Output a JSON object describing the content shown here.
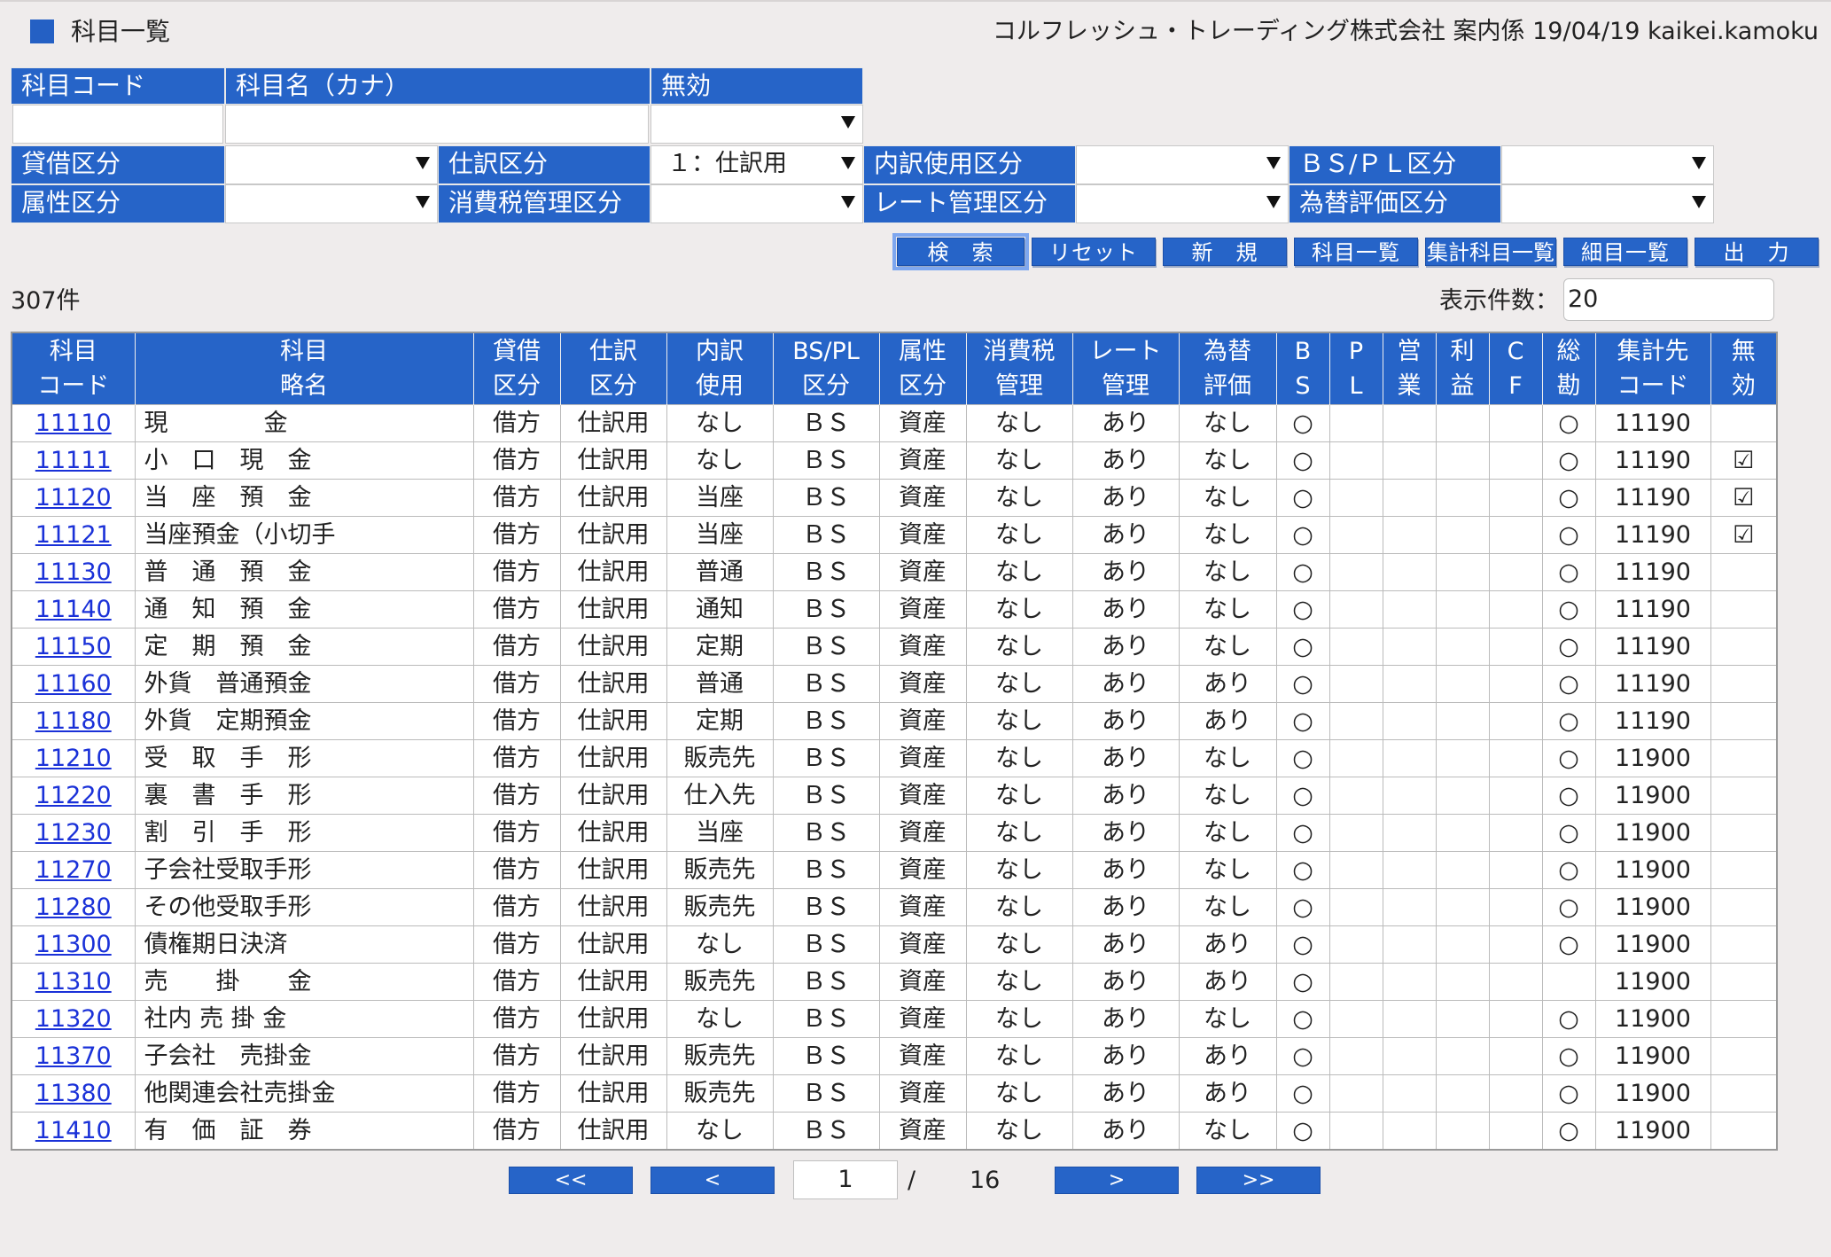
{
  "header": {
    "title": "科目一覧",
    "info": "コルフレッシュ・トレーディング株式会社 案内係 19/04/19 kaikei.kamoku"
  },
  "search": {
    "code_label": "科目コード",
    "code_value": "",
    "kana_label": "科目名（カナ）",
    "kana_value": "",
    "invalid_label": "無効",
    "invalid_value": "",
    "taishaku_label": "貸借区分",
    "taishaku_value": "",
    "shiwake_label": "仕訳区分",
    "shiwake_value": "１：仕訳用",
    "uchiwake_label": "内訳使用区分",
    "uchiwake_value": "",
    "bspl_label": "ＢＳ/ＰＬ区分",
    "bspl_value": "",
    "zokusei_label": "属性区分",
    "zokusei_value": "",
    "shohizei_label": "消費税管理区分",
    "shohizei_value": "",
    "rate_label": "レート管理区分",
    "rate_value": "",
    "kawase_label": "為替評価区分",
    "kawase_value": ""
  },
  "buttons": {
    "search": "検　索",
    "reset": "リセット",
    "new": "新　規",
    "kamoku_list": "科目一覧",
    "shukei_list": "集計科目一覧",
    "saimoku_list": "細目一覧",
    "output": "出　力"
  },
  "result_count": "307件",
  "page_size_label": "表示件数：",
  "page_size_value": "20",
  "columns": [
    [
      "科目",
      "コード"
    ],
    [
      "科目",
      "略名"
    ],
    [
      "貸借",
      "区分"
    ],
    [
      "仕訳",
      "区分"
    ],
    [
      "内訳",
      "使用"
    ],
    [
      "BS/PL",
      "区分"
    ],
    [
      "属性",
      "区分"
    ],
    [
      "消費税",
      "管理"
    ],
    [
      "レート",
      "管理"
    ],
    [
      "為替",
      "評価"
    ],
    [
      "B",
      "S"
    ],
    [
      "P",
      "L"
    ],
    [
      "営",
      "業"
    ],
    [
      "利",
      "益"
    ],
    [
      "C",
      "F"
    ],
    [
      "総",
      "勘"
    ],
    [
      "集計先",
      "コード"
    ],
    [
      "無",
      "効"
    ]
  ],
  "rows": [
    [
      "11110",
      "現　　　　金",
      "借方",
      "仕訳用",
      "なし",
      "ＢＳ",
      "資産",
      "なし",
      "あり",
      "なし",
      "○",
      "",
      "",
      "",
      "",
      "○",
      "11190",
      ""
    ],
    [
      "11111",
      "小　口　現　金",
      "借方",
      "仕訳用",
      "なし",
      "ＢＳ",
      "資産",
      "なし",
      "あり",
      "なし",
      "○",
      "",
      "",
      "",
      "",
      "○",
      "11190",
      "☑"
    ],
    [
      "11120",
      "当　座　預　金",
      "借方",
      "仕訳用",
      "当座",
      "ＢＳ",
      "資産",
      "なし",
      "あり",
      "なし",
      "○",
      "",
      "",
      "",
      "",
      "○",
      "11190",
      "☑"
    ],
    [
      "11121",
      "当座預金（小切手",
      "借方",
      "仕訳用",
      "当座",
      "ＢＳ",
      "資産",
      "なし",
      "あり",
      "なし",
      "○",
      "",
      "",
      "",
      "",
      "○",
      "11190",
      "☑"
    ],
    [
      "11130",
      "普　通　預　金",
      "借方",
      "仕訳用",
      "普通",
      "ＢＳ",
      "資産",
      "なし",
      "あり",
      "なし",
      "○",
      "",
      "",
      "",
      "",
      "○",
      "11190",
      ""
    ],
    [
      "11140",
      "通　知　預　金",
      "借方",
      "仕訳用",
      "通知",
      "ＢＳ",
      "資産",
      "なし",
      "あり",
      "なし",
      "○",
      "",
      "",
      "",
      "",
      "○",
      "11190",
      ""
    ],
    [
      "11150",
      "定　期　預　金",
      "借方",
      "仕訳用",
      "定期",
      "ＢＳ",
      "資産",
      "なし",
      "あり",
      "なし",
      "○",
      "",
      "",
      "",
      "",
      "○",
      "11190",
      ""
    ],
    [
      "11160",
      "外貨　普通預金",
      "借方",
      "仕訳用",
      "普通",
      "ＢＳ",
      "資産",
      "なし",
      "あり",
      "あり",
      "○",
      "",
      "",
      "",
      "",
      "○",
      "11190",
      ""
    ],
    [
      "11180",
      "外貨　定期預金",
      "借方",
      "仕訳用",
      "定期",
      "ＢＳ",
      "資産",
      "なし",
      "あり",
      "あり",
      "○",
      "",
      "",
      "",
      "",
      "○",
      "11190",
      ""
    ],
    [
      "11210",
      "受　取　手　形",
      "借方",
      "仕訳用",
      "販売先",
      "ＢＳ",
      "資産",
      "なし",
      "あり",
      "なし",
      "○",
      "",
      "",
      "",
      "",
      "○",
      "11900",
      ""
    ],
    [
      "11220",
      "裏　書　手　形",
      "借方",
      "仕訳用",
      "仕入先",
      "ＢＳ",
      "資産",
      "なし",
      "あり",
      "なし",
      "○",
      "",
      "",
      "",
      "",
      "○",
      "11900",
      ""
    ],
    [
      "11230",
      "割　引　手　形",
      "借方",
      "仕訳用",
      "当座",
      "ＢＳ",
      "資産",
      "なし",
      "あり",
      "なし",
      "○",
      "",
      "",
      "",
      "",
      "○",
      "11900",
      ""
    ],
    [
      "11270",
      "子会社受取手形",
      "借方",
      "仕訳用",
      "販売先",
      "ＢＳ",
      "資産",
      "なし",
      "あり",
      "なし",
      "○",
      "",
      "",
      "",
      "",
      "○",
      "11900",
      ""
    ],
    [
      "11280",
      "その他受取手形",
      "借方",
      "仕訳用",
      "販売先",
      "ＢＳ",
      "資産",
      "なし",
      "あり",
      "なし",
      "○",
      "",
      "",
      "",
      "",
      "○",
      "11900",
      ""
    ],
    [
      "11300",
      "債権期日決済",
      "借方",
      "仕訳用",
      "なし",
      "ＢＳ",
      "資産",
      "なし",
      "あり",
      "あり",
      "○",
      "",
      "",
      "",
      "",
      "○",
      "11900",
      ""
    ],
    [
      "11310",
      "売　　掛　　金",
      "借方",
      "仕訳用",
      "販売先",
      "ＢＳ",
      "資産",
      "なし",
      "あり",
      "あり",
      "○",
      "",
      "",
      "",
      "",
      "",
      "11900",
      ""
    ],
    [
      "11320",
      "社内 売 掛 金",
      "借方",
      "仕訳用",
      "なし",
      "ＢＳ",
      "資産",
      "なし",
      "あり",
      "なし",
      "○",
      "",
      "",
      "",
      "",
      "○",
      "11900",
      ""
    ],
    [
      "11370",
      "子会社　売掛金",
      "借方",
      "仕訳用",
      "販売先",
      "ＢＳ",
      "資産",
      "なし",
      "あり",
      "あり",
      "○",
      "",
      "",
      "",
      "",
      "○",
      "11900",
      ""
    ],
    [
      "11380",
      "他関連会社売掛金",
      "借方",
      "仕訳用",
      "販売先",
      "ＢＳ",
      "資産",
      "なし",
      "あり",
      "あり",
      "○",
      "",
      "",
      "",
      "",
      "○",
      "11900",
      ""
    ],
    [
      "11410",
      "有　価　証　券",
      "借方",
      "仕訳用",
      "なし",
      "ＢＳ",
      "資産",
      "なし",
      "あり",
      "なし",
      "○",
      "",
      "",
      "",
      "",
      "○",
      "11900",
      ""
    ]
  ],
  "pager": {
    "first": "<<",
    "prev": "<",
    "current": "1",
    "separator": "/",
    "total": "16",
    "next": ">",
    "last": ">>"
  },
  "colors": {
    "header_blue": "#2664c8",
    "link": "#1a31d8",
    "background": "#efecec"
  }
}
